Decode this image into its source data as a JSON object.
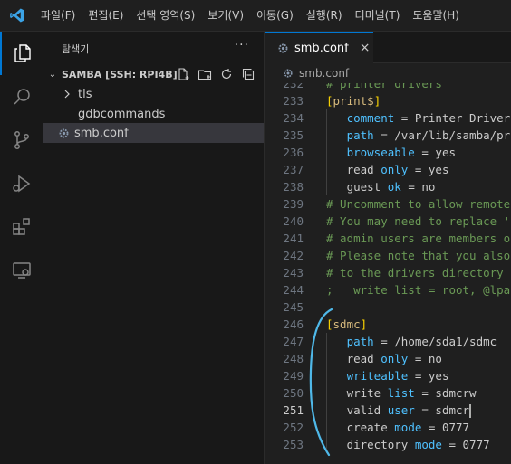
{
  "menu": [
    "파일(F)",
    "편집(E)",
    "선택 영역(S)",
    "보기(V)",
    "이동(G)",
    "실행(R)",
    "터미널(T)",
    "도움말(H)"
  ],
  "sidebar": {
    "title": "탐색기",
    "more": "···",
    "section": "SAMBA [SSH: RPI4B]",
    "items": [
      {
        "label": "tls",
        "kind": "folder"
      },
      {
        "label": "gdbcommands",
        "kind": "file"
      },
      {
        "label": "smb.conf",
        "kind": "settings-file"
      }
    ]
  },
  "editor": {
    "tab_label": "smb.conf",
    "tab_close": "×",
    "breadcrumb": "smb.conf",
    "current_line": 251,
    "lines": [
      {
        "n": 232,
        "segments": [
          {
            "t": "# printer drivers",
            "c": "com"
          }
        ]
      },
      {
        "n": 233,
        "segments": [
          {
            "t": "[print$]",
            "c": "sec"
          }
        ]
      },
      {
        "n": 234,
        "segments": [
          {
            "t": "   "
          },
          {
            "t": "comment",
            "c": "key"
          },
          {
            "t": " = Printer Drivers",
            "c": "val"
          }
        ]
      },
      {
        "n": 235,
        "segments": [
          {
            "t": "   "
          },
          {
            "t": "path",
            "c": "key"
          },
          {
            "t": " = /var/lib/samba/printers",
            "c": "val"
          }
        ]
      },
      {
        "n": 236,
        "segments": [
          {
            "t": "   "
          },
          {
            "t": "browseable",
            "c": "key"
          },
          {
            "t": " = yes",
            "c": "val"
          }
        ]
      },
      {
        "n": 237,
        "segments": [
          {
            "t": "   read ",
            "c": "val"
          },
          {
            "t": "only",
            "c": "key"
          },
          {
            "t": " = yes",
            "c": "val"
          }
        ]
      },
      {
        "n": 238,
        "segments": [
          {
            "t": "   guest ",
            "c": "val"
          },
          {
            "t": "ok",
            "c": "key"
          },
          {
            "t": " = no",
            "c": "val"
          }
        ]
      },
      {
        "n": 239,
        "segments": [
          {
            "t": "# Uncomment to allow remote administration",
            "c": "com"
          }
        ]
      },
      {
        "n": 240,
        "segments": [
          {
            "t": "# You may need to replace 'lpadmin'",
            "c": "com"
          }
        ]
      },
      {
        "n": 241,
        "segments": [
          {
            "t": "# admin users are members of",
            "c": "com"
          }
        ]
      },
      {
        "n": 242,
        "segments": [
          {
            "t": "# Please note that you also",
            "c": "com"
          }
        ]
      },
      {
        "n": 243,
        "segments": [
          {
            "t": "# to the drivers directory",
            "c": "com"
          }
        ]
      },
      {
        "n": 244,
        "segments": [
          {
            "t": ";   write list = root, @lpadmin",
            "c": "com"
          }
        ]
      },
      {
        "n": 245,
        "segments": []
      },
      {
        "n": 246,
        "segments": [
          {
            "t": "[sdmc]",
            "c": "sec"
          }
        ]
      },
      {
        "n": 247,
        "segments": [
          {
            "t": "   "
          },
          {
            "t": "path",
            "c": "key"
          },
          {
            "t": " = /home/sda1/sdmc",
            "c": "val"
          }
        ]
      },
      {
        "n": 248,
        "segments": [
          {
            "t": "   read ",
            "c": "val"
          },
          {
            "t": "only",
            "c": "key"
          },
          {
            "t": " = no",
            "c": "val"
          }
        ]
      },
      {
        "n": 249,
        "segments": [
          {
            "t": "   "
          },
          {
            "t": "writeable",
            "c": "key"
          },
          {
            "t": " = yes",
            "c": "val"
          }
        ]
      },
      {
        "n": 250,
        "segments": [
          {
            "t": "   write ",
            "c": "val"
          },
          {
            "t": "list",
            "c": "key"
          },
          {
            "t": " = sdmcrw",
            "c": "val"
          }
        ]
      },
      {
        "n": 251,
        "segments": [
          {
            "t": "   valid ",
            "c": "val"
          },
          {
            "t": "user",
            "c": "key"
          },
          {
            "t": " = sdmcr",
            "c": "val"
          }
        ]
      },
      {
        "n": 252,
        "segments": [
          {
            "t": "   create ",
            "c": "val"
          },
          {
            "t": "mode",
            "c": "key"
          },
          {
            "t": " = 0777",
            "c": "val"
          }
        ]
      },
      {
        "n": 253,
        "segments": [
          {
            "t": "   directory ",
            "c": "val"
          },
          {
            "t": "mode",
            "c": "key"
          },
          {
            "t": " = 0777",
            "c": "val"
          }
        ]
      }
    ]
  },
  "colors": {
    "accent": "#0078d4",
    "annotation": "#4fb8e8"
  }
}
